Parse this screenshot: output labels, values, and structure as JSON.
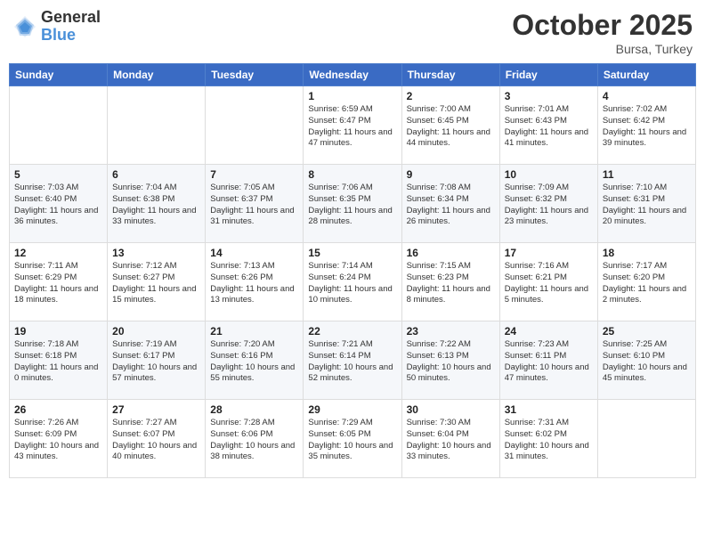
{
  "logo": {
    "general": "General",
    "blue": "Blue"
  },
  "header": {
    "month": "October 2025",
    "location": "Bursa, Turkey"
  },
  "days_of_week": [
    "Sunday",
    "Monday",
    "Tuesday",
    "Wednesday",
    "Thursday",
    "Friday",
    "Saturday"
  ],
  "weeks": [
    [
      {
        "day": "",
        "info": ""
      },
      {
        "day": "",
        "info": ""
      },
      {
        "day": "",
        "info": ""
      },
      {
        "day": "1",
        "info": "Sunrise: 6:59 AM\nSunset: 6:47 PM\nDaylight: 11 hours and 47 minutes."
      },
      {
        "day": "2",
        "info": "Sunrise: 7:00 AM\nSunset: 6:45 PM\nDaylight: 11 hours and 44 minutes."
      },
      {
        "day": "3",
        "info": "Sunrise: 7:01 AM\nSunset: 6:43 PM\nDaylight: 11 hours and 41 minutes."
      },
      {
        "day": "4",
        "info": "Sunrise: 7:02 AM\nSunset: 6:42 PM\nDaylight: 11 hours and 39 minutes."
      }
    ],
    [
      {
        "day": "5",
        "info": "Sunrise: 7:03 AM\nSunset: 6:40 PM\nDaylight: 11 hours and 36 minutes."
      },
      {
        "day": "6",
        "info": "Sunrise: 7:04 AM\nSunset: 6:38 PM\nDaylight: 11 hours and 33 minutes."
      },
      {
        "day": "7",
        "info": "Sunrise: 7:05 AM\nSunset: 6:37 PM\nDaylight: 11 hours and 31 minutes."
      },
      {
        "day": "8",
        "info": "Sunrise: 7:06 AM\nSunset: 6:35 PM\nDaylight: 11 hours and 28 minutes."
      },
      {
        "day": "9",
        "info": "Sunrise: 7:08 AM\nSunset: 6:34 PM\nDaylight: 11 hours and 26 minutes."
      },
      {
        "day": "10",
        "info": "Sunrise: 7:09 AM\nSunset: 6:32 PM\nDaylight: 11 hours and 23 minutes."
      },
      {
        "day": "11",
        "info": "Sunrise: 7:10 AM\nSunset: 6:31 PM\nDaylight: 11 hours and 20 minutes."
      }
    ],
    [
      {
        "day": "12",
        "info": "Sunrise: 7:11 AM\nSunset: 6:29 PM\nDaylight: 11 hours and 18 minutes."
      },
      {
        "day": "13",
        "info": "Sunrise: 7:12 AM\nSunset: 6:27 PM\nDaylight: 11 hours and 15 minutes."
      },
      {
        "day": "14",
        "info": "Sunrise: 7:13 AM\nSunset: 6:26 PM\nDaylight: 11 hours and 13 minutes."
      },
      {
        "day": "15",
        "info": "Sunrise: 7:14 AM\nSunset: 6:24 PM\nDaylight: 11 hours and 10 minutes."
      },
      {
        "day": "16",
        "info": "Sunrise: 7:15 AM\nSunset: 6:23 PM\nDaylight: 11 hours and 8 minutes."
      },
      {
        "day": "17",
        "info": "Sunrise: 7:16 AM\nSunset: 6:21 PM\nDaylight: 11 hours and 5 minutes."
      },
      {
        "day": "18",
        "info": "Sunrise: 7:17 AM\nSunset: 6:20 PM\nDaylight: 11 hours and 2 minutes."
      }
    ],
    [
      {
        "day": "19",
        "info": "Sunrise: 7:18 AM\nSunset: 6:18 PM\nDaylight: 11 hours and 0 minutes."
      },
      {
        "day": "20",
        "info": "Sunrise: 7:19 AM\nSunset: 6:17 PM\nDaylight: 10 hours and 57 minutes."
      },
      {
        "day": "21",
        "info": "Sunrise: 7:20 AM\nSunset: 6:16 PM\nDaylight: 10 hours and 55 minutes."
      },
      {
        "day": "22",
        "info": "Sunrise: 7:21 AM\nSunset: 6:14 PM\nDaylight: 10 hours and 52 minutes."
      },
      {
        "day": "23",
        "info": "Sunrise: 7:22 AM\nSunset: 6:13 PM\nDaylight: 10 hours and 50 minutes."
      },
      {
        "day": "24",
        "info": "Sunrise: 7:23 AM\nSunset: 6:11 PM\nDaylight: 10 hours and 47 minutes."
      },
      {
        "day": "25",
        "info": "Sunrise: 7:25 AM\nSunset: 6:10 PM\nDaylight: 10 hours and 45 minutes."
      }
    ],
    [
      {
        "day": "26",
        "info": "Sunrise: 7:26 AM\nSunset: 6:09 PM\nDaylight: 10 hours and 43 minutes."
      },
      {
        "day": "27",
        "info": "Sunrise: 7:27 AM\nSunset: 6:07 PM\nDaylight: 10 hours and 40 minutes."
      },
      {
        "day": "28",
        "info": "Sunrise: 7:28 AM\nSunset: 6:06 PM\nDaylight: 10 hours and 38 minutes."
      },
      {
        "day": "29",
        "info": "Sunrise: 7:29 AM\nSunset: 6:05 PM\nDaylight: 10 hours and 35 minutes."
      },
      {
        "day": "30",
        "info": "Sunrise: 7:30 AM\nSunset: 6:04 PM\nDaylight: 10 hours and 33 minutes."
      },
      {
        "day": "31",
        "info": "Sunrise: 7:31 AM\nSunset: 6:02 PM\nDaylight: 10 hours and 31 minutes."
      },
      {
        "day": "",
        "info": ""
      }
    ]
  ]
}
